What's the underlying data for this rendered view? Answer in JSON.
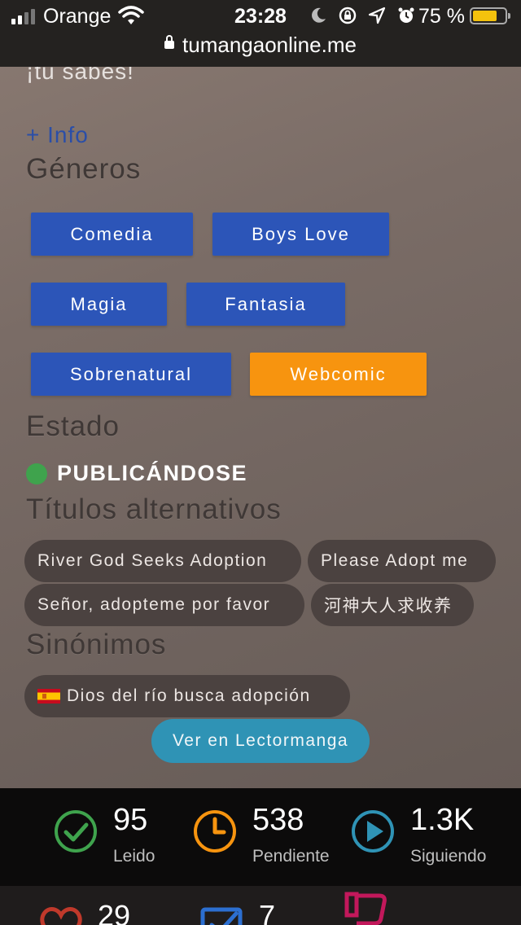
{
  "status_bar": {
    "carrier": "Orange",
    "time": "23:28",
    "battery_pct": "75 %",
    "battery_level": 0.75,
    "url": "tumangaonline.me"
  },
  "intro": {
    "clipped_text": "¡tu sabes!",
    "info_link": "+ Info"
  },
  "sections": {
    "generos": "Géneros",
    "estado": "Estado",
    "titulos": "Títulos alternativos",
    "sinonimos": "Sinónimos"
  },
  "genres": [
    "Comedia",
    "Boys Love",
    "Magia",
    "Fantasia",
    "Sobrenatural",
    "Webcomic"
  ],
  "estado": {
    "value": "PUBLICÁNDOSE",
    "color": "#3fa34d"
  },
  "alt_titles": [
    "River God Seeks Adoption",
    "Please Adopt me",
    "Señor, adopteme por favor",
    "河神大人求收养"
  ],
  "synonyms": [
    "Dios del río busca adopción"
  ],
  "lector_button": "Ver en Lectormanga",
  "stats": [
    {
      "value": "95",
      "label": "Leido",
      "icon": "check-circle-icon",
      "color": "#3fa34d"
    },
    {
      "value": "538",
      "label": "Pendiente",
      "icon": "clock-icon",
      "color": "#f7940f"
    },
    {
      "value": "1.3K",
      "label": "Siguiendo",
      "icon": "play-circle-icon",
      "color": "#2f93b5"
    }
  ],
  "stats2": [
    {
      "value": "29",
      "icon": "heart-icon",
      "color": "#c0392b"
    },
    {
      "value": "7",
      "icon": "checkbox-icon",
      "color": "#2c6fd1"
    },
    {
      "value": "",
      "icon": "thumbs-down-icon",
      "color": "#c2185b"
    }
  ],
  "colors": {
    "genre_blue": "#2c55b8",
    "genre_orange": "#f7940f",
    "lector_button": "#2f93b5"
  }
}
